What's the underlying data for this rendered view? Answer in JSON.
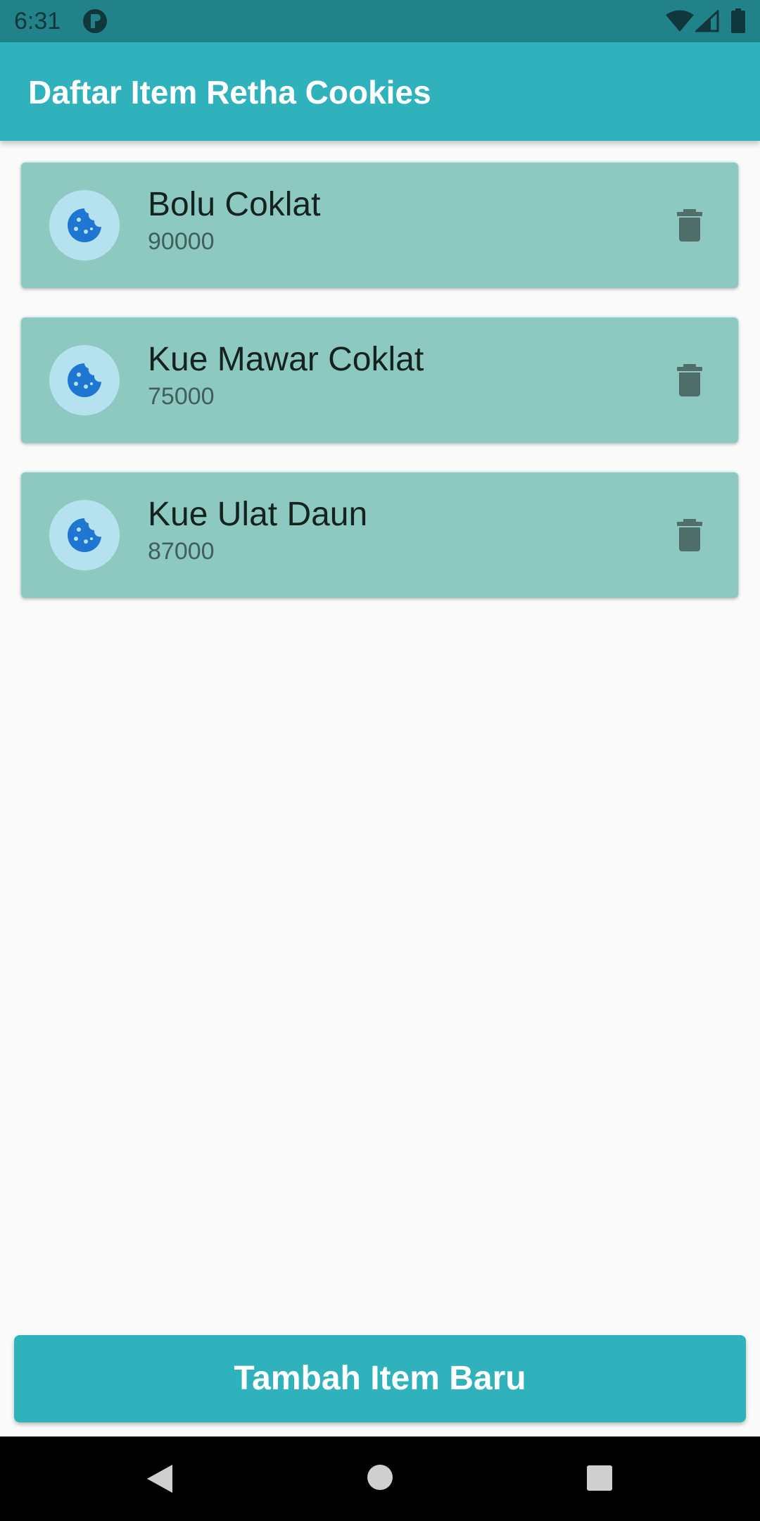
{
  "status_bar": {
    "time": "6:31",
    "icons": [
      "notification-app-icon",
      "wifi-icon",
      "cell-signal-icon",
      "battery-icon"
    ]
  },
  "app_bar": {
    "title": "Daftar Item Retha Cookies",
    "color": "#2fb2bc"
  },
  "items": [
    {
      "name": "Bolu Coklat",
      "price": "90000",
      "icon": "cookie-icon",
      "action_icon": "delete-icon"
    },
    {
      "name": "Kue Mawar Coklat",
      "price": "75000",
      "icon": "cookie-icon",
      "action_icon": "delete-icon"
    },
    {
      "name": "Kue Ulat Daun",
      "price": "87000",
      "icon": "cookie-icon",
      "action_icon": "delete-icon"
    }
  ],
  "add_button": {
    "label": "Tambah Item Baru"
  },
  "nav_bar": {
    "icons": [
      "back-icon",
      "home-icon",
      "recents-icon"
    ]
  },
  "colors": {
    "status_bar": "#218289",
    "card": "#8dc9c1",
    "avatar": "#b5e2ee",
    "cookie": "#1e76d2",
    "delete": "#4f6e6a"
  }
}
